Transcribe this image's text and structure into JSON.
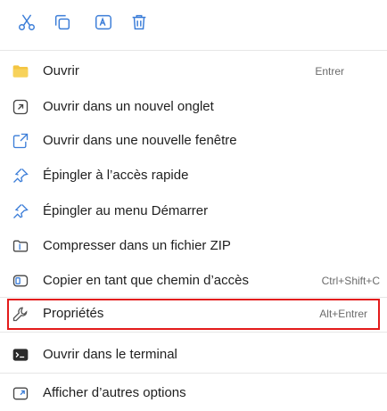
{
  "toolbar": {
    "buttons": [
      {
        "icon": "cut-icon"
      },
      {
        "icon": "copy-icon"
      },
      {
        "icon": "rename-icon"
      },
      {
        "icon": "delete-icon"
      }
    ]
  },
  "menu": {
    "items": [
      {
        "label": "Ouvrir",
        "shortcut": "Entrer",
        "icon": "folder-icon"
      },
      {
        "label": "Ouvrir dans un nouvel onglet",
        "shortcut": "",
        "icon": "new-tab-icon"
      },
      {
        "label": "Ouvrir dans une nouvelle fenêtre",
        "shortcut": "",
        "icon": "new-window-icon"
      },
      {
        "label": "Épingler à l’accès rapide",
        "shortcut": "",
        "icon": "pin-icon"
      },
      {
        "label": "Épingler au menu Démarrer",
        "shortcut": "",
        "icon": "pin-icon"
      },
      {
        "label": "Compresser dans un fichier ZIP",
        "shortcut": "",
        "icon": "zip-icon"
      },
      {
        "label": "Copier en tant que chemin d’accès",
        "shortcut": "Ctrl+Shift+C",
        "icon": "copy-path-icon"
      },
      {
        "label": "Propriétés",
        "shortcut": "Alt+Entrer",
        "icon": "wrench-icon",
        "highlighted": true
      },
      {
        "label": "Ouvrir dans le terminal",
        "shortcut": "",
        "icon": "terminal-icon"
      },
      {
        "label": "Afficher d’autres options",
        "shortcut": "",
        "icon": "more-options-icon"
      }
    ]
  },
  "colors": {
    "highlight_border": "#e31b1b",
    "icon_blue": "#3b7dd8",
    "folder_yellow": "#f4c542"
  }
}
